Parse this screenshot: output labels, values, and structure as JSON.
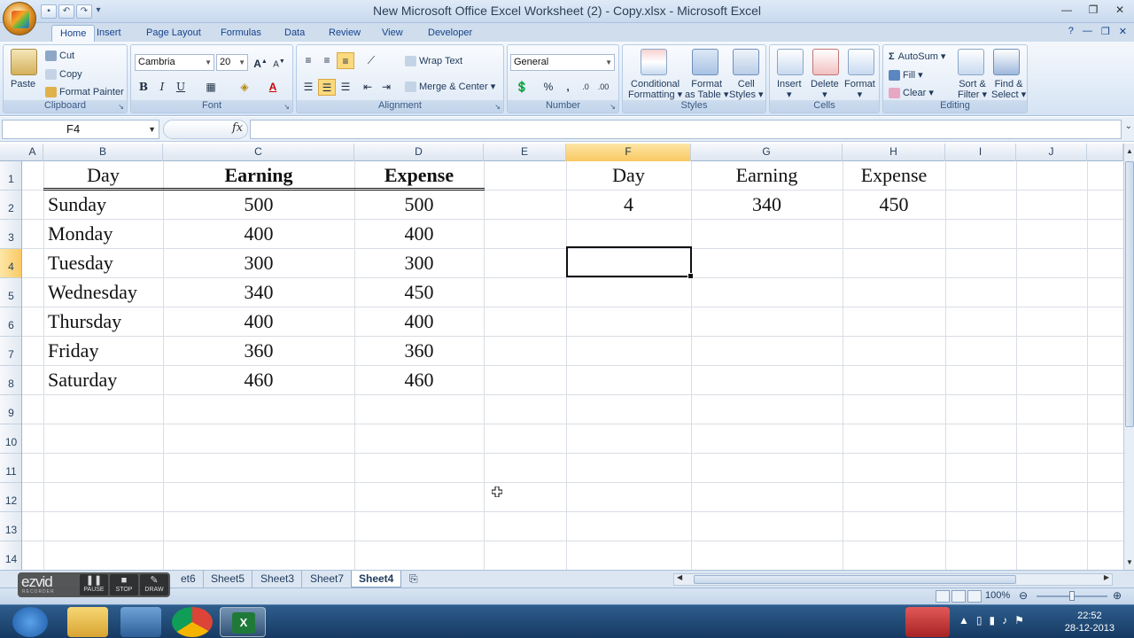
{
  "window": {
    "title": "New Microsoft Office Excel Worksheet (2) - Copy.xlsx - Microsoft Excel"
  },
  "ribbon_tabs": [
    "Home",
    "Insert",
    "Page Layout",
    "Formulas",
    "Data",
    "Review",
    "View",
    "Developer"
  ],
  "active_tab": "Home",
  "clipboard": {
    "paste": "Paste",
    "cut": "Cut",
    "copy": "Copy",
    "format_painter": "Format Painter",
    "label": "Clipboard"
  },
  "font": {
    "family": "Cambria",
    "size": "20",
    "bold": "B",
    "italic": "I",
    "underline": "U",
    "label": "Font"
  },
  "alignment": {
    "wrap": "Wrap Text",
    "merge": "Merge & Center",
    "label": "Alignment"
  },
  "number": {
    "format": "General",
    "percent": "%",
    "comma": ",",
    "label": "Number"
  },
  "styles": {
    "conditional": "Conditional",
    "conditional2": "Formatting",
    "format_table": "Format",
    "format_table2": "as Table",
    "cell_styles": "Cell",
    "cell_styles2": "Styles",
    "label": "Styles"
  },
  "cells_group": {
    "insert": "Insert",
    "delete": "Delete",
    "format": "Format",
    "label": "Cells"
  },
  "editing": {
    "autosum": "AutoSum",
    "fill": "Fill",
    "clear": "Clear",
    "sort": "Sort &",
    "sort2": "Filter",
    "find": "Find &",
    "find2": "Select",
    "label": "Editing"
  },
  "formula_bar": {
    "name_box": "F4",
    "fx": "fx",
    "formula": ""
  },
  "columns": [
    "A",
    "B",
    "C",
    "D",
    "E",
    "F",
    "G",
    "H",
    "I",
    "J"
  ],
  "rows": [
    "1",
    "2",
    "3",
    "4",
    "5",
    "6",
    "7",
    "8",
    "9",
    "10",
    "11",
    "12",
    "13",
    "14"
  ],
  "table1": {
    "headers": [
      "Day",
      "Earning",
      "Expense"
    ],
    "rows": [
      [
        "Sunday",
        "500",
        "500"
      ],
      [
        "Monday",
        "400",
        "400"
      ],
      [
        "Tuesday",
        "300",
        "300"
      ],
      [
        "Wednesday",
        "340",
        "450"
      ],
      [
        "Thursday",
        "400",
        "400"
      ],
      [
        "Friday",
        "360",
        "360"
      ],
      [
        "Saturday",
        "460",
        "460"
      ]
    ]
  },
  "table2": {
    "headers": [
      "Day",
      "Earning",
      "Expense"
    ],
    "row": [
      "4",
      "340",
      "450"
    ]
  },
  "sheets": [
    "et6",
    "Sheet5",
    "Sheet3",
    "Sheet7",
    "Sheet4"
  ],
  "active_sheet": "Sheet4",
  "ezvid": {
    "logo": "ezvid",
    "sub": "RECORDER",
    "pause": "PAUSE",
    "stop": "STOP",
    "draw": "DRAW"
  },
  "status": {
    "zoom": "100%"
  },
  "clock": {
    "time": "22:52",
    "date": "28-12-2013"
  }
}
